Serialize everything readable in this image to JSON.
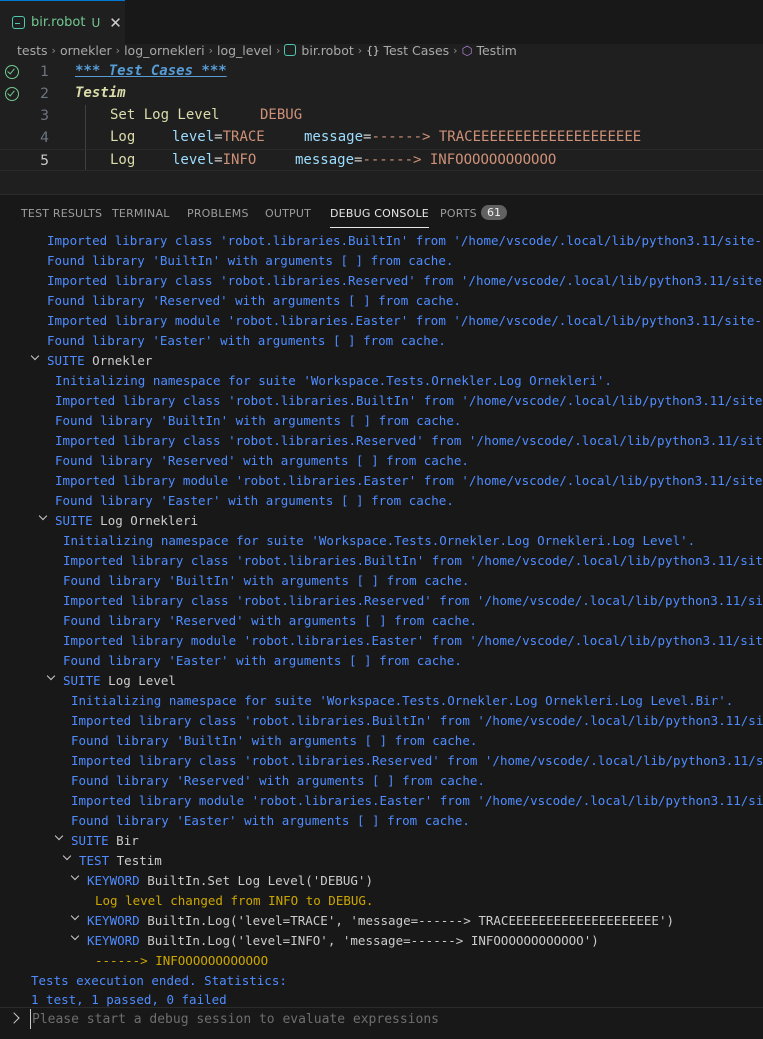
{
  "tab": {
    "filename": "bir.robot",
    "modified": "U",
    "close": "✕"
  },
  "breadcrumb": [
    "tests",
    "ornekler",
    "log_ornekleri",
    "log_level",
    "bir.robot",
    "Test Cases",
    "Testim"
  ],
  "editor": {
    "lines": [
      {
        "num": "1",
        "header": "*** Test Cases ***"
      },
      {
        "num": "2",
        "testname": "Testim"
      },
      {
        "num": "3",
        "keyword": "Set Log Level",
        "arg": "DEBUG"
      },
      {
        "num": "4",
        "keyword": "Log",
        "n1": "level",
        "v1": "TRACE",
        "n2": "message",
        "v2": "------> TRACEEEEEEEEEEEEEEEEEEEE"
      },
      {
        "num": "5",
        "keyword": "Log",
        "n1": "level",
        "v1": "INFO",
        "n2": "message",
        "v2": "------> INFOOOOOOOOOOOO"
      }
    ],
    "eq": "="
  },
  "panel_tabs": [
    "TEST RESULTS",
    "TERMINAL",
    "PROBLEMS",
    "OUTPUT",
    "DEBUG CONSOLE",
    "PORTS"
  ],
  "ports_count": "61",
  "suite_key": "SUITE",
  "test_key": "TEST",
  "keyword_key": "KEYWORD",
  "console": {
    "top": [
      "Imported library class 'robot.libraries.BuiltIn' from '/home/vscode/.local/lib/python3.11/site-packages/robot/libraries/BuiltIn.py'.",
      "Found library 'BuiltIn' with arguments [ ] from cache.",
      "Imported library class 'robot.libraries.Reserved' from '/home/vscode/.local/lib/python3.11/site-packages/robot/libraries/Reserved.py'.",
      "Found library 'Reserved' with arguments [ ] from cache.",
      "Imported library module 'robot.libraries.Easter' from '/home/vscode/.local/lib/python3.11/site-packages/robot/libraries/Easter.py'.",
      "Found library 'Easter' with arguments [ ] from cache."
    ],
    "suite1": {
      "name": "Ornekler",
      "lines": [
        "Initializing namespace for suite 'Workspace.Tests.Ornekler.Log Ornekleri'.",
        "Imported library class 'robot.libraries.BuiltIn' from '/home/vscode/.local/lib/python3.11/site-packages/robot/libraries/BuiltIn.py'.",
        "Found library 'BuiltIn' with arguments [ ] from cache.",
        "Imported library class 'robot.libraries.Reserved' from '/home/vscode/.local/lib/python3.11/site-packages/robot/libraries/Reserved.py'.",
        "Found library 'Reserved' with arguments [ ] from cache.",
        "Imported library module 'robot.libraries.Easter' from '/home/vscode/.local/lib/python3.11/site-packages/robot/libraries/Easter.py'.",
        "Found library 'Easter' with arguments [ ] from cache."
      ]
    },
    "suite2": {
      "name": "Log Ornekleri",
      "lines": [
        "Initializing namespace for suite 'Workspace.Tests.Ornekler.Log Ornekleri.Log Level'.",
        "Imported library class 'robot.libraries.BuiltIn' from '/home/vscode/.local/lib/python3.11/site-packages/robot/libraries/BuiltIn.py'.",
        "Found library 'BuiltIn' with arguments [ ] from cache.",
        "Imported library class 'robot.libraries.Reserved' from '/home/vscode/.local/lib/python3.11/site-packages/robot/libraries/Reserved.py'.",
        "Found library 'Reserved' with arguments [ ] from cache.",
        "Imported library module 'robot.libraries.Easter' from '/home/vscode/.local/lib/python3.11/site-packages/robot/libraries/Easter.py'.",
        "Found library 'Easter' with arguments [ ] from cache."
      ]
    },
    "suite3": {
      "name": "Log Level",
      "lines": [
        "Initializing namespace for suite 'Workspace.Tests.Ornekler.Log Ornekleri.Log Level.Bir'.",
        "Imported library class 'robot.libraries.BuiltIn' from '/home/vscode/.local/lib/python3.11/site-packages/robot/libraries/BuiltIn.py'.",
        "Found library 'BuiltIn' with arguments [ ] from cache.",
        "Imported library class 'robot.libraries.Reserved' from '/home/vscode/.local/lib/python3.11/site-packages/robot/libraries/Reserved.py'.",
        "Found library 'Reserved' with arguments [ ] from cache.",
        "Imported library module 'robot.libraries.Easter' from '/home/vscode/.local/lib/python3.11/site-packages/robot/libraries/Easter.py'.",
        "Found library 'Easter' with arguments [ ] from cache."
      ]
    },
    "suite4": {
      "name": "Bir"
    },
    "test": {
      "name": "Testim"
    },
    "kw1": {
      "call": "BuiltIn.Set Log Level('DEBUG')",
      "msg": "Log level changed from INFO to DEBUG."
    },
    "kw2": {
      "call": "BuiltIn.Log('level=TRACE', 'message=------> TRACEEEEEEEEEEEEEEEEEEEE')"
    },
    "kw3": {
      "call": "BuiltIn.Log('level=INFO', 'message=------> INFOOOOOOOOOOOO')",
      "msg": "------> INFOOOOOOOOOOOO"
    },
    "end1": "Tests execution ended. Statistics:",
    "end2": "1 test, 1 passed, 0 failed"
  },
  "input": {
    "placeholder": "Please start a debug session to evaluate expressions"
  },
  "colors": {
    "accent": "#0078d4",
    "console_text": "#4f8cff",
    "warning": "#cca700",
    "pass": "#73c991"
  }
}
